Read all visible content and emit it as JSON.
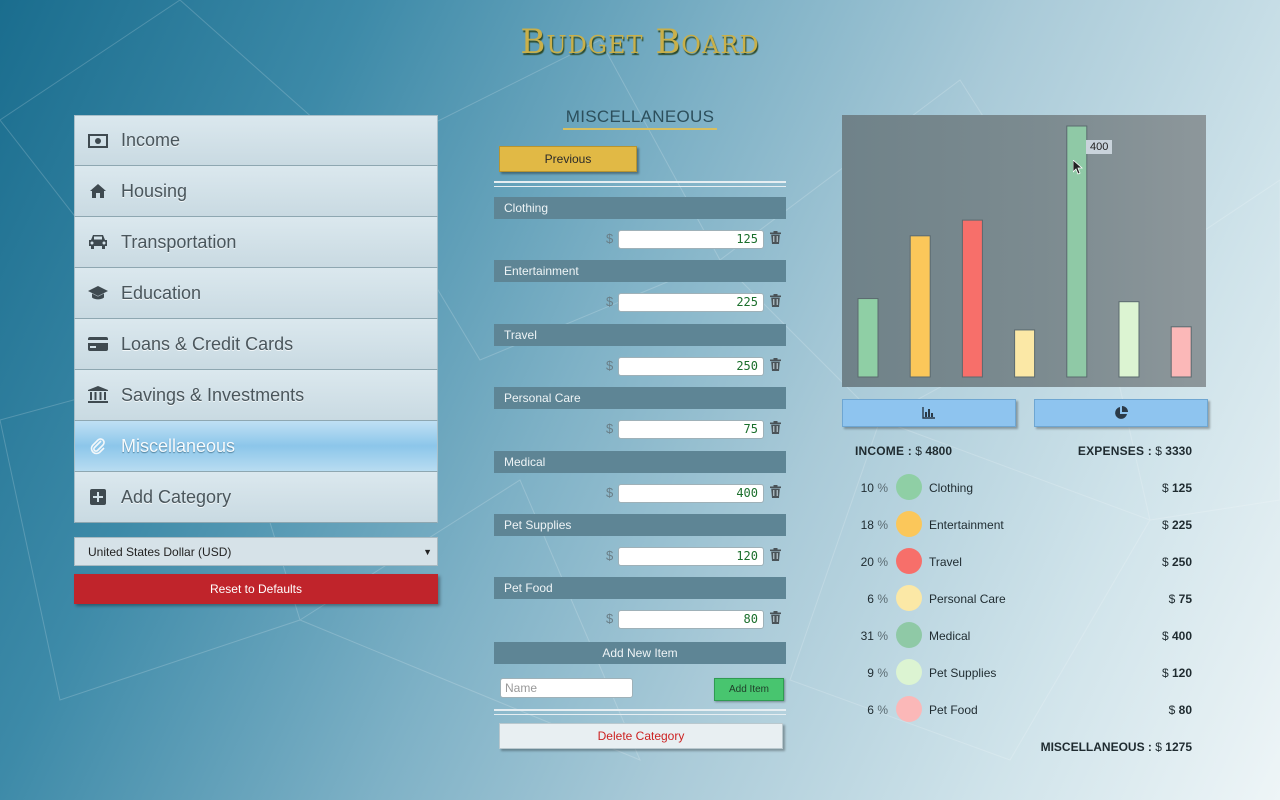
{
  "app": {
    "title": "Budget Board"
  },
  "sidebar": {
    "items": [
      {
        "label": "Income",
        "icon": "money-icon"
      },
      {
        "label": "Housing",
        "icon": "home-icon"
      },
      {
        "label": "Transportation",
        "icon": "car-icon"
      },
      {
        "label": "Education",
        "icon": "graduation-cap-icon"
      },
      {
        "label": "Loans & Credit Cards",
        "icon": "credit-card-icon"
      },
      {
        "label": "Savings & Investments",
        "icon": "bank-icon"
      },
      {
        "label": "Miscellaneous",
        "icon": "paperclip-icon",
        "active": true
      },
      {
        "label": "Add Category",
        "icon": "plus-square-icon"
      }
    ],
    "currency": "United States Dollar (USD)",
    "reset_label": "Reset to Defaults"
  },
  "category": {
    "title": "MISCELLANEOUS",
    "previous_label": "Previous",
    "currency_symbol": "$",
    "items": [
      {
        "name": "Clothing",
        "amount": "125"
      },
      {
        "name": "Entertainment",
        "amount": "225"
      },
      {
        "name": "Travel",
        "amount": "250"
      },
      {
        "name": "Personal Care",
        "amount": "75"
      },
      {
        "name": "Medical",
        "amount": "400"
      },
      {
        "name": "Pet Supplies",
        "amount": "120"
      },
      {
        "name": "Pet Food",
        "amount": "80"
      }
    ],
    "add_new_label": "Add New Item",
    "name_placeholder": "Name",
    "add_item_label": "Add Item",
    "delete_label": "Delete Category"
  },
  "summary": {
    "income_label": "INCOME :",
    "income_value": "4800",
    "expenses_label": "EXPENSES :",
    "expenses_value": "3330",
    "currency_symbol": "$",
    "percent_symbol": "%",
    "total_label": "MISCELLANEOUS :",
    "total_value": "1275",
    "rows": [
      {
        "pct": "10",
        "name": "Clothing",
        "value": "125",
        "color": "#8fcfa5"
      },
      {
        "pct": "18",
        "name": "Entertainment",
        "value": "225",
        "color": "#fbc75a"
      },
      {
        "pct": "20",
        "name": "Travel",
        "value": "250",
        "color": "#f76f6a"
      },
      {
        "pct": "6",
        "name": "Personal Care",
        "value": "75",
        "color": "#fbe8a6"
      },
      {
        "pct": "31",
        "name": "Medical",
        "value": "400",
        "color": "#8fc9a6"
      },
      {
        "pct": "9",
        "name": "Pet Supplies",
        "value": "120",
        "color": "#dcf4d2"
      },
      {
        "pct": "6",
        "name": "Pet Food",
        "value": "80",
        "color": "#fbb8b8"
      }
    ]
  },
  "chart_data": {
    "type": "bar",
    "categories": [
      "Clothing",
      "Entertainment",
      "Travel",
      "Personal Care",
      "Medical",
      "Pet Supplies",
      "Pet Food"
    ],
    "values": [
      125,
      225,
      250,
      75,
      400,
      120,
      80
    ],
    "colors": [
      "#8fcfa5",
      "#fbc75a",
      "#f76f6a",
      "#fbe8a6",
      "#8fc9a6",
      "#dcf4d2",
      "#fbb8b8"
    ],
    "ylim": [
      0,
      400
    ],
    "tooltip": "400",
    "tooltip_index": 4
  },
  "chart_buttons": {
    "bar_icon": "bar-chart-icon",
    "pie_icon": "pie-chart-icon"
  }
}
